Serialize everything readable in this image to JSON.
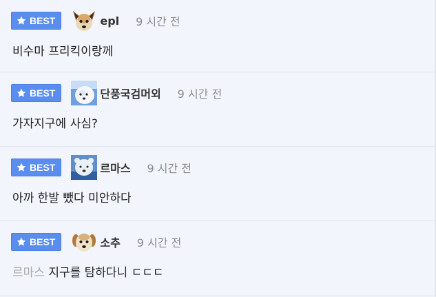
{
  "best_label": "BEST",
  "colors": {
    "badge": "#5b8def",
    "background": "#f2f5fb",
    "time": "#8a8a8a",
    "mention": "#a8a8a8"
  },
  "comments": [
    {
      "nickname": "epl",
      "time": "9 시간 전",
      "avatar_icon": "dog-face-icon",
      "text": "비수마 프리킥이랑께",
      "mention": ""
    },
    {
      "nickname": "단풍국검머외",
      "time": "9 시간 전",
      "avatar_icon": "white-dog-icon",
      "text": "가자지구에 사심?",
      "mention": ""
    },
    {
      "nickname": "르마스",
      "time": "9 시간 전",
      "avatar_icon": "polar-bear-icon",
      "text": "아까 한발 뺐다 미안하다",
      "mention": ""
    },
    {
      "nickname": "소추",
      "time": "9 시간 전",
      "avatar_icon": "puppy-face-icon",
      "text": "지구를 탐하다니 ㄷㄷㄷ",
      "mention": "르마스"
    }
  ]
}
